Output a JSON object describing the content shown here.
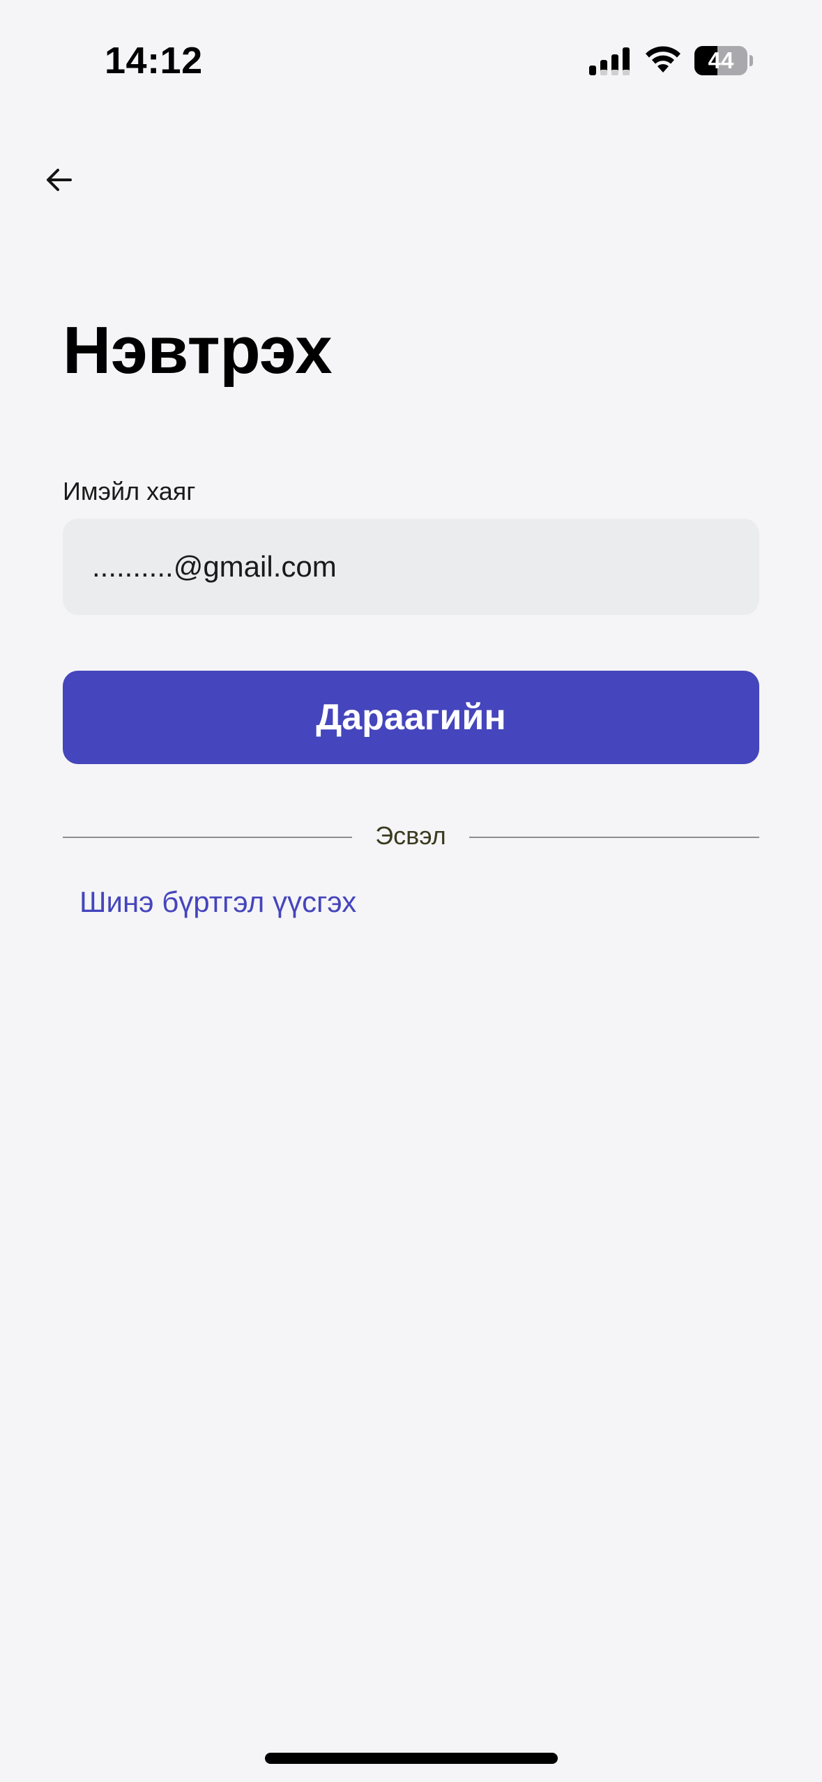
{
  "status_bar": {
    "time": "14:12",
    "battery_level": "44",
    "battery_percent": 44,
    "signal_icon": "cellular-signal-icon",
    "wifi_icon": "wifi-icon"
  },
  "nav": {
    "back_icon": "arrow-left-icon"
  },
  "login": {
    "title": "Нэвтрэх",
    "email_label": "Имэйл хаяг",
    "email_value": "..........@gmail.com",
    "next_label": "Дараагийн",
    "divider_text": "Эсвэл",
    "register_link": "Шинэ бүртгэл үүсгэх"
  },
  "colors": {
    "background": "#f5f5f7",
    "primary": "#4545bd",
    "input_background": "#ebecee",
    "text": "#000000"
  }
}
